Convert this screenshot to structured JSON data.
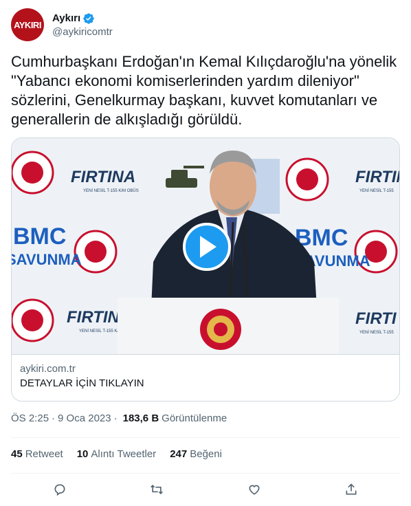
{
  "author": {
    "avatar_text": "AYKIRI",
    "display_name": "Aykırı",
    "handle": "@aykiricomtr"
  },
  "tweet": {
    "text": "Cumhurbaşkanı Erdoğan'ın Kemal Kılıçdaroğlu'na yönelik \"Yabancı ekonomi komiserlerinden yardım dileniyor\" sözlerini, Genelkurmay başkanı, kuvvet komutanları ve generallerin de alkışladığı görüldü."
  },
  "card": {
    "domain": "aykiri.com.tr",
    "title": "DETAYLAR İÇİN TIKLAYIN",
    "backdrop_left_top": "FIRTINA",
    "backdrop_left_top_sub": "YENİ NESİL T-155 K/M OBÜS",
    "backdrop_bmc_top": "BMC",
    "backdrop_bmc_bottom": "SAVUNMA",
    "backdrop_right_top": "FIRTINA",
    "backdrop_right_sub": "YENİ NESİL T-155",
    "backdrop_left_bottom": "FIRTINA",
    "backdrop_left_bottom_sub": "YENİ NESİL T-155 K/M OBÜS",
    "backdrop_right_bottom": "FIRTI",
    "backdrop_right_bottom_sub": "YENİ NESİL T-155"
  },
  "meta": {
    "time": "ÖS 2:25",
    "date": "9 Oca 2023",
    "dot": "·",
    "views_count": "183,6 B",
    "views_label": "Görüntülenme"
  },
  "stats": {
    "retweets_count": "45",
    "retweets_label": "Retweet",
    "quotes_count": "10",
    "quotes_label": "Alıntı Tweetler",
    "likes_count": "247",
    "likes_label": "Beğeni"
  },
  "colors": {
    "accent": "#1d9bf0",
    "brand_red": "#b3121b",
    "muted": "#536471",
    "border": "#cfd9de"
  },
  "icons": [
    "verified-badge-icon",
    "play-icon",
    "reply-icon",
    "retweet-icon",
    "like-icon",
    "share-icon"
  ]
}
